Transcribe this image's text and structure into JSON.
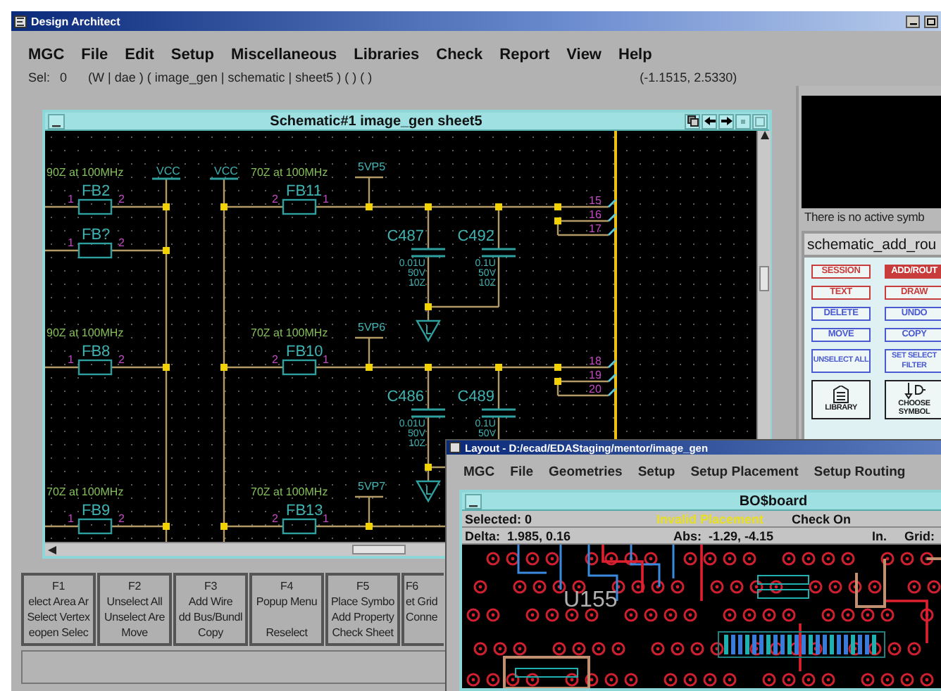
{
  "window": {
    "title": "Design Architect"
  },
  "menu": [
    "MGC",
    "File",
    "Edit",
    "Setup",
    "Miscellaneous",
    "Libraries",
    "Check",
    "Report",
    "View",
    "Help"
  ],
  "selection_bar": {
    "label": "Sel:",
    "count": "0",
    "context": "(W | dae ) ( image_gen | schematic | sheet5 ) ( ) ( )",
    "coordinates": "(-1.1515, 2.5330)"
  },
  "schematic_window": {
    "title": "Schematic#1 image_gen sheet5",
    "blocks": [
      {
        "bead_left": {
          "rating": "90Z at 100MHz",
          "ref": "FB2",
          "pins": [
            "1",
            "2"
          ]
        },
        "bead_extra": {
          "ref": "FB?",
          "pins": [
            "1",
            "2"
          ]
        },
        "power": [
          "VCC",
          "VCC"
        ],
        "bead_right": {
          "rating": "70Z at 100MHz",
          "ref": "FB11",
          "pins": [
            "2",
            "1"
          ]
        },
        "supply": "5VP5",
        "caps": [
          {
            "ref": "C487",
            "value": "0.01U",
            "voltage": "50V",
            "tolerance": "10Z"
          },
          {
            "ref": "C492",
            "value": "0.1U",
            "voltage": "50V",
            "tolerance": "10Z"
          }
        ],
        "pins": [
          "15",
          "16",
          "17"
        ]
      },
      {
        "bead_left": {
          "rating": "90Z at 100MHz",
          "ref": "FB8",
          "pins": [
            "1",
            "2"
          ]
        },
        "bead_right": {
          "rating": "70Z at 100MHz",
          "ref": "FB10",
          "pins": [
            "2",
            "1"
          ]
        },
        "supply": "5VP6",
        "caps": [
          {
            "ref": "C486",
            "value": "0.01U",
            "voltage": "50V",
            "tolerance": "10Z"
          },
          {
            "ref": "C489",
            "value": "0.1U",
            "voltage": "50V"
          }
        ],
        "pins": [
          "18",
          "19",
          "20"
        ]
      },
      {
        "bead_left": {
          "rating": "70Z at 100MHz",
          "ref": "FB9",
          "pins": [
            "1",
            "2"
          ]
        },
        "bead_right": {
          "rating": "70Z at 100MHz",
          "ref": "FB13",
          "pins": [
            "2",
            "1"
          ]
        },
        "supply": "5VP7"
      }
    ]
  },
  "symbol_panel": {
    "message": "There is no active symb"
  },
  "palette": {
    "title": "schematic_add_rou",
    "buttons": [
      {
        "label": "SESSION",
        "kind": "text",
        "color": "#c83c3c",
        "selected": false
      },
      {
        "label": "ADD/ROUT",
        "kind": "text",
        "color": "#c83c3c",
        "selected": true
      },
      {
        "label": "TEXT",
        "kind": "text",
        "color": "#c83c3c",
        "selected": false
      },
      {
        "label": "DRAW",
        "kind": "text",
        "color": "#c83c3c",
        "selected": false
      },
      {
        "label": "DELETE",
        "kind": "text",
        "color": "#4a5ad0",
        "selected": false
      },
      {
        "label": "UNDO",
        "kind": "text",
        "color": "#4a5ad0",
        "selected": false
      },
      {
        "label": "MOVE",
        "kind": "text",
        "color": "#4a5ad0",
        "selected": false
      },
      {
        "label": "COPY",
        "kind": "text",
        "color": "#4a5ad0",
        "selected": false
      },
      {
        "label": "UNSELECT ALL",
        "kind": "text",
        "color": "#4a5ad0",
        "selected": false
      },
      {
        "label": "SET SELECT FILTER",
        "kind": "text",
        "color": "#4a5ad0",
        "selected": false
      },
      {
        "label": "LIBRARY",
        "kind": "library",
        "color": "#202020",
        "selected": false
      },
      {
        "label": "CHOOSE SYMBOL",
        "kind": "symbol",
        "color": "#202020",
        "selected": false
      }
    ]
  },
  "function_keys": [
    {
      "key": "F1",
      "top": "elect Area Ar",
      "middle": "Select Vertex",
      "bottom": "eopen Selec"
    },
    {
      "key": "F2",
      "top": "Unselect All",
      "middle": "Unselect Are",
      "bottom": "Move"
    },
    {
      "key": "F3",
      "top": "Add Wire",
      "middle": "dd Bus/Bundl",
      "bottom": "Copy"
    },
    {
      "key": "F4",
      "top": "Popup Menu",
      "bottom": "Reselect"
    },
    {
      "key": "F5",
      "top": "Place Symbo",
      "middle": "Add Property",
      "bottom": "Check Sheet"
    },
    {
      "key": "F6",
      "top": "et Grid",
      "middle": "Conne"
    }
  ],
  "layout_window": {
    "title": "Layout - D:/ecad/EDAStaging/mentor/image_gen",
    "menu": [
      "MGC",
      "File",
      "Geometries",
      "Setup",
      "Setup Placement",
      "Setup Routing"
    ],
    "board": {
      "title": "BO$board",
      "selected": "Selected: 0",
      "warning": "Invalid Placement",
      "check": "Check On",
      "delta": "Delta:  1.985, 0.16",
      "abs": "Abs:  -1.29, -4.15",
      "units": "In.",
      "grid": "Grid:",
      "part_label": "U155"
    }
  }
}
